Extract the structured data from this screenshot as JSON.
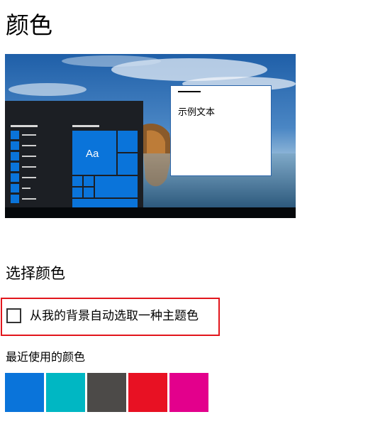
{
  "page": {
    "title": "颜色"
  },
  "preview": {
    "tile_label": "Aa",
    "sample_text": "示例文本",
    "accent_color": "#0A74DA"
  },
  "choose_color": {
    "heading": "选择颜色",
    "auto_pick_checkbox": {
      "label": "从我的背景自动选取一种主题色",
      "checked": false,
      "highlight_color": "#E2161C"
    }
  },
  "recent_colors": {
    "heading": "最近使用的颜色",
    "swatches": [
      "#0A74DA",
      "#00B7C3",
      "#4C4A48",
      "#E81123",
      "#E3008C"
    ]
  }
}
